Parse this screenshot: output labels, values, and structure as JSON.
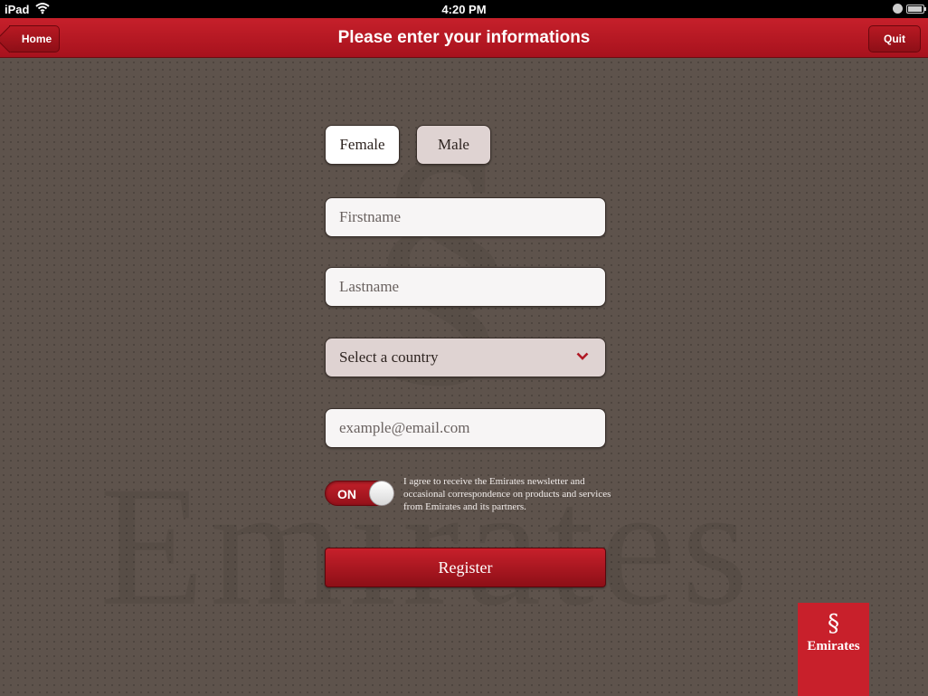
{
  "status_bar": {
    "carrier": "iPad",
    "time": "4:20 PM"
  },
  "nav": {
    "title": "Please enter your informations",
    "home_label": "Home",
    "quit_label": "Quit"
  },
  "form": {
    "gender": {
      "female_label": "Female",
      "male_label": "Male",
      "selected": "Female"
    },
    "firstname_placeholder": "Firstname",
    "lastname_placeholder": "Lastname",
    "country_label": "Select a country",
    "email_placeholder": "example@email.com",
    "newsletter": {
      "toggle_label": "ON",
      "state": true,
      "text": "I agree to receive the Emirates newsletter and occasional correspondence on products and services from Emirates and its partners."
    },
    "register_label": "Register"
  },
  "branding": {
    "logo_text": "Emirates",
    "accent_color": "#c8202b"
  },
  "icons": {
    "wifi": "wifi-icon",
    "country_dropdown": "chevron-down-icon",
    "back": "back-arrow-icon"
  }
}
